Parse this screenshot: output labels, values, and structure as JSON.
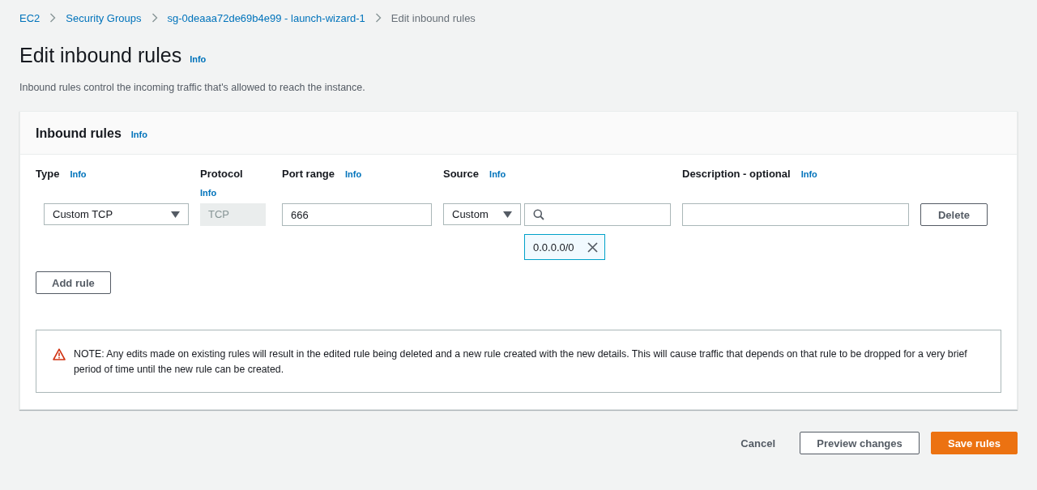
{
  "breadcrumbs": [
    {
      "label": "EC2",
      "current": false
    },
    {
      "label": "Security Groups",
      "current": false
    },
    {
      "label": "sg-0deaaa72de69b4e99 - launch-wizard-1",
      "current": false
    },
    {
      "label": "Edit inbound rules",
      "current": true
    }
  ],
  "page": {
    "title": "Edit inbound rules",
    "info": "Info",
    "description": "Inbound rules control the incoming traffic that's allowed to reach the instance."
  },
  "panel": {
    "title": "Inbound rules",
    "info": "Info",
    "columns": [
      {
        "label": "Type",
        "info": "Info"
      },
      {
        "label": "Protocol",
        "info": "Info"
      },
      {
        "label": "Port range",
        "info": "Info"
      },
      {
        "label": "Source",
        "info": "Info"
      },
      {
        "label": "Description - optional",
        "info": "Info"
      }
    ],
    "rules": [
      {
        "type": "Custom TCP",
        "protocol": "TCP",
        "port_range": "666",
        "source_type": "Custom",
        "source_tokens": [
          "0.0.0.0/0"
        ],
        "delete": "Delete"
      }
    ],
    "add_rule": "Add rule",
    "note": "NOTE: Any edits made on existing rules will result in the edited rule being deleted and a new rule created with the new details. This will cause traffic that depends on that rule to be dropped for a very brief period of time until the new rule can be created."
  },
  "footer": {
    "cancel": "Cancel",
    "preview": "Preview changes",
    "save": "Save rules"
  }
}
